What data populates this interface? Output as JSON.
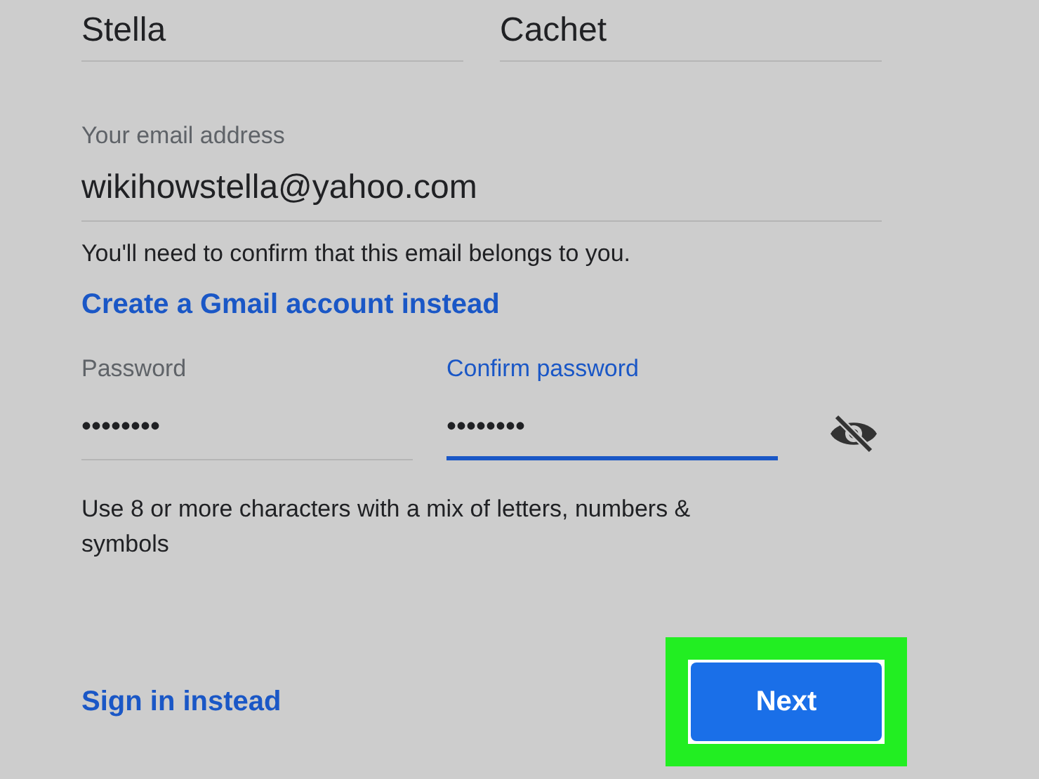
{
  "name_fields": [
    {
      "value": "Stella"
    },
    {
      "value": "Cachet"
    }
  ],
  "email": {
    "label": "Your email address",
    "value": "wikihowstella@yahoo.com"
  },
  "email_note": "You'll need to confirm that this email belongs to you.",
  "gmail_link": "Create a Gmail account instead",
  "password_fields": [
    {
      "label": "Password",
      "value": "••••••••",
      "focused": false
    },
    {
      "label": "Confirm password",
      "value": "••••••••",
      "focused": true
    }
  ],
  "show_password": false,
  "password_hint": "Use 8 or more characters with a mix of letters, numbers & symbols",
  "sign_in_link": "Sign in instead",
  "next_button": {
    "label": "Next",
    "highlighted": true
  }
}
